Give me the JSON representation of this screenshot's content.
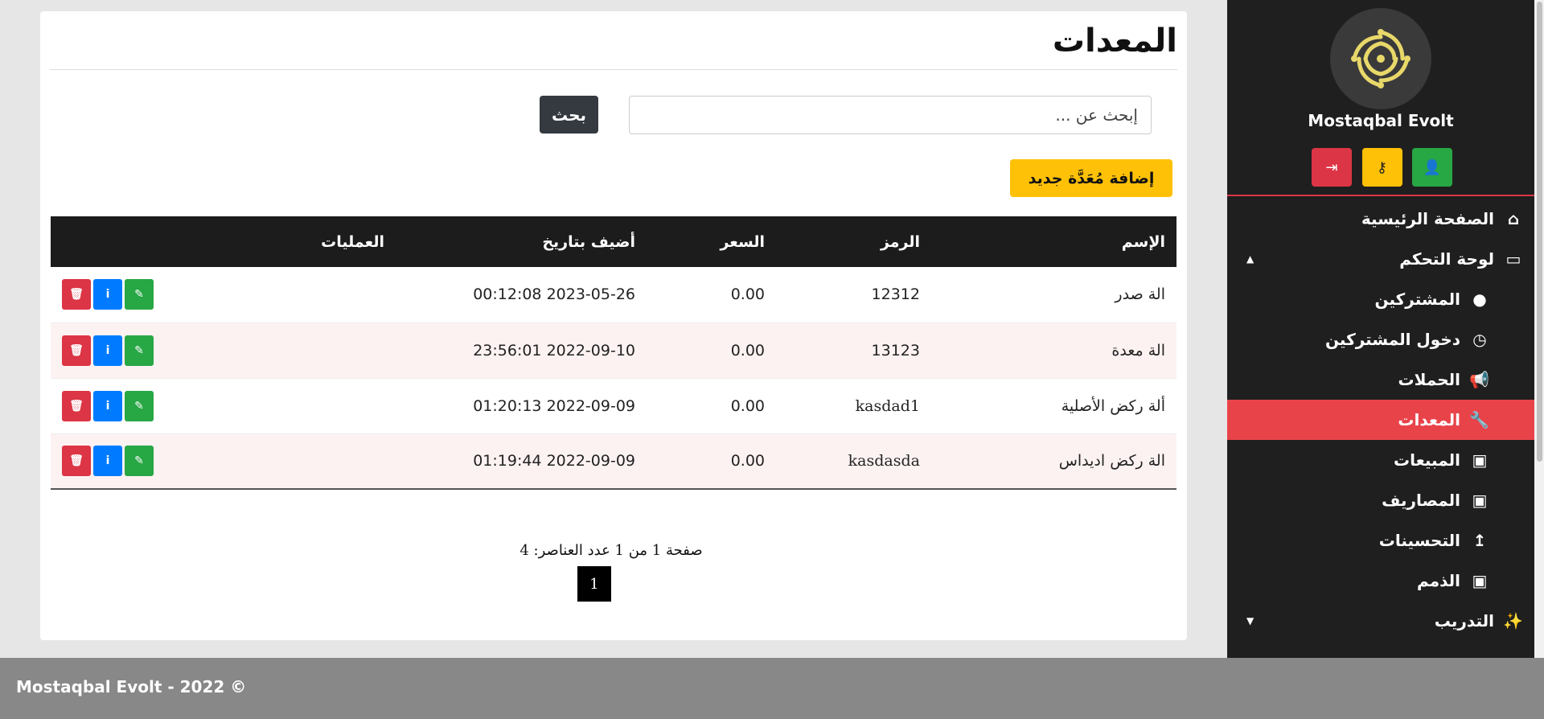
{
  "page": {
    "title": "المعدات",
    "search": {
      "placeholder": "إبحث عن ...",
      "button": "بحث"
    },
    "add_button": "إضافة مُعَدَّة جديد"
  },
  "table": {
    "headers": [
      "الإسم",
      "الرمز",
      "السعر",
      "أضيف بتاريخ",
      "العمليات"
    ],
    "rows": [
      {
        "name": "الة صدر",
        "code": "12312",
        "price": "0.00",
        "date": "2023-05-26 00:12:08"
      },
      {
        "name": "الة معدة",
        "code": "13123",
        "price": "0.00",
        "date": "2022-09-10 23:56:01"
      },
      {
        "name": "ألة ركض الأصلية",
        "code": "kasdad1",
        "price": "0.00",
        "date": "2022-09-09 01:20:13"
      },
      {
        "name": "الة ركض اديداس",
        "code": "kasdasda",
        "price": "0.00",
        "date": "2022-09-09 01:19:44"
      }
    ]
  },
  "pagination": {
    "summary": "صفحة 1 من 1 عدد العناصر: 4",
    "current_page": "1"
  },
  "sidebar": {
    "brand": "Mostaqbal Evolt",
    "items": [
      {
        "label": "الصفحة الرئيسية",
        "icon": "home-icon"
      },
      {
        "label": "لوحة التحكم",
        "icon": "laptop-icon",
        "caret": "▲"
      },
      {
        "label": "المشتركين",
        "icon": "user-icon"
      },
      {
        "label": "دخول المشتركين",
        "icon": "clock-icon"
      },
      {
        "label": "الحملات",
        "icon": "bullhorn-icon"
      },
      {
        "label": "المعدات",
        "icon": "wrench-icon",
        "active": true
      },
      {
        "label": "المبيعات",
        "icon": "money-icon"
      },
      {
        "label": "المصاريف",
        "icon": "money-icon"
      },
      {
        "label": "التحسينات",
        "icon": "level-up-icon"
      },
      {
        "label": "الذمم",
        "icon": "money-icon"
      },
      {
        "label": "التدريب",
        "icon": "magic-wand-icon",
        "caret": "▼"
      }
    ]
  },
  "colors": {
    "active": "#e9434a",
    "sidebar_bg": "#1f1f1f",
    "accent_yellow": "#ffc107"
  },
  "footer": {
    "text": "Mostaqbal Evolt - 2022 ©"
  }
}
